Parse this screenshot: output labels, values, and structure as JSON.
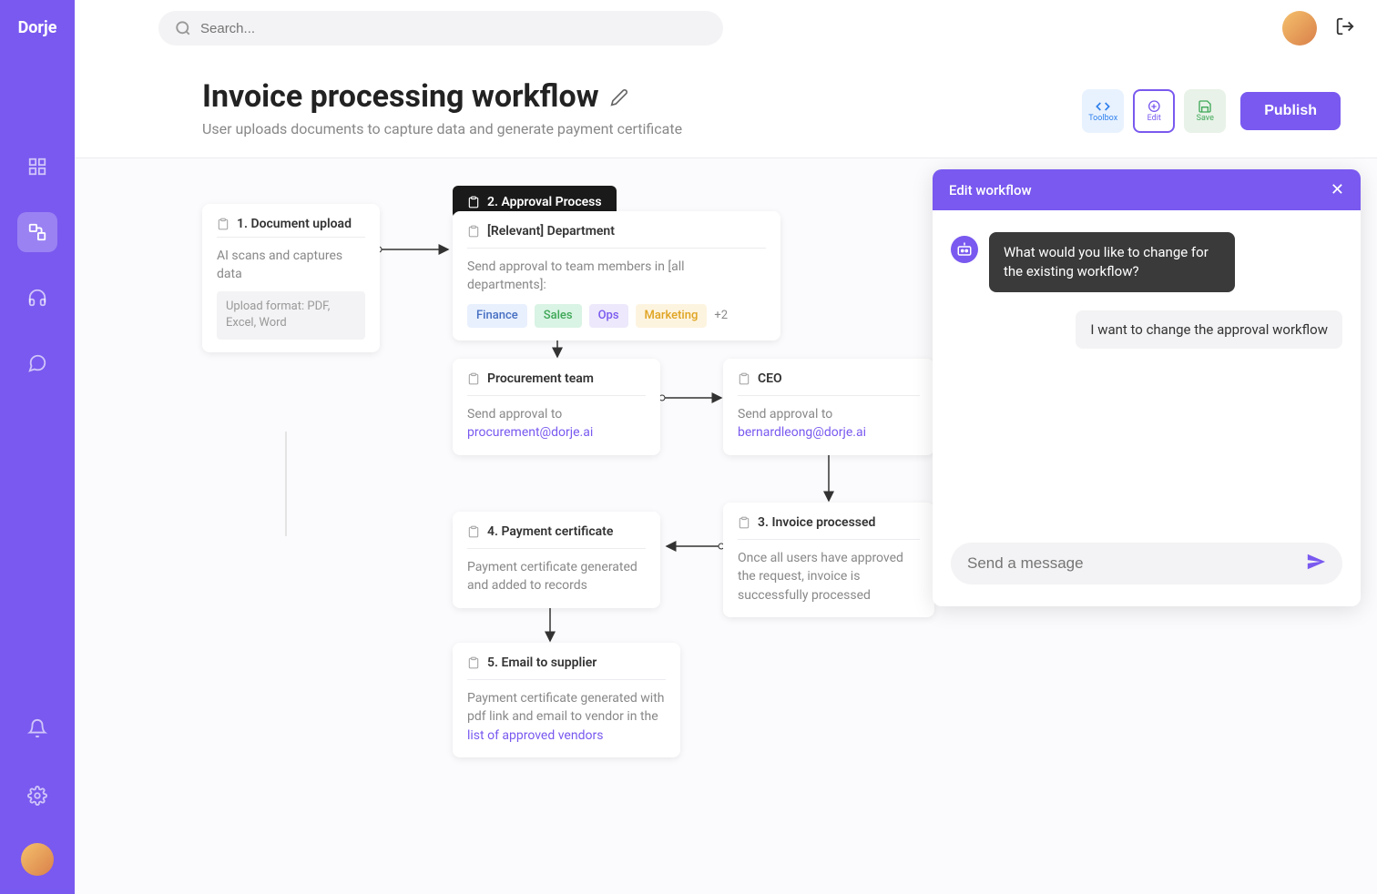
{
  "brand": "Dorje",
  "search": {
    "placeholder": "Search..."
  },
  "header": {
    "title": "Invoice processing workflow",
    "subtitle": "User uploads documents to capture data and generate payment certificate",
    "toolbox_label": "Toolbox",
    "edit_label": "Edit",
    "save_label": "Save",
    "publish_label": "Publish"
  },
  "nodes": {
    "doc_upload": {
      "title": "1. Document upload",
      "desc": "AI scans and captures data",
      "format": "Upload format: PDF, Excel, Word"
    },
    "approval_tag": "2. Approval Process",
    "department": {
      "title": "[Relevant]  Department",
      "desc": "Send approval to team members in [all departments]:",
      "tags": {
        "finance": "Finance",
        "sales": "Sales",
        "ops": "Ops",
        "marketing": "Marketing",
        "more": "+2"
      }
    },
    "procurement": {
      "title": "Procurement team",
      "desc": "Send approval to ",
      "email": "procurement@dorje.ai"
    },
    "ceo": {
      "title": "CEO",
      "desc": "Send approval to ",
      "email": "bernardleong@dorje.ai"
    },
    "invoice_processed": {
      "title": "3. Invoice processed",
      "desc": "Once all users have approved the request, invoice is successfully processed"
    },
    "payment_cert": {
      "title": "4. Payment certificate",
      "desc": "Payment certificate generated and added to records"
    },
    "email_supplier": {
      "title": "5. Email to supplier",
      "desc_prefix": "Payment certificate generated with pdf link and email to vendor in the ",
      "link": "list of approved vendors"
    }
  },
  "chat": {
    "title": "Edit workflow",
    "bot_msg": "What would you like to change for the existing workflow?",
    "user_msg": "I want to change the approval workflow",
    "input_placeholder": "Send a message"
  }
}
